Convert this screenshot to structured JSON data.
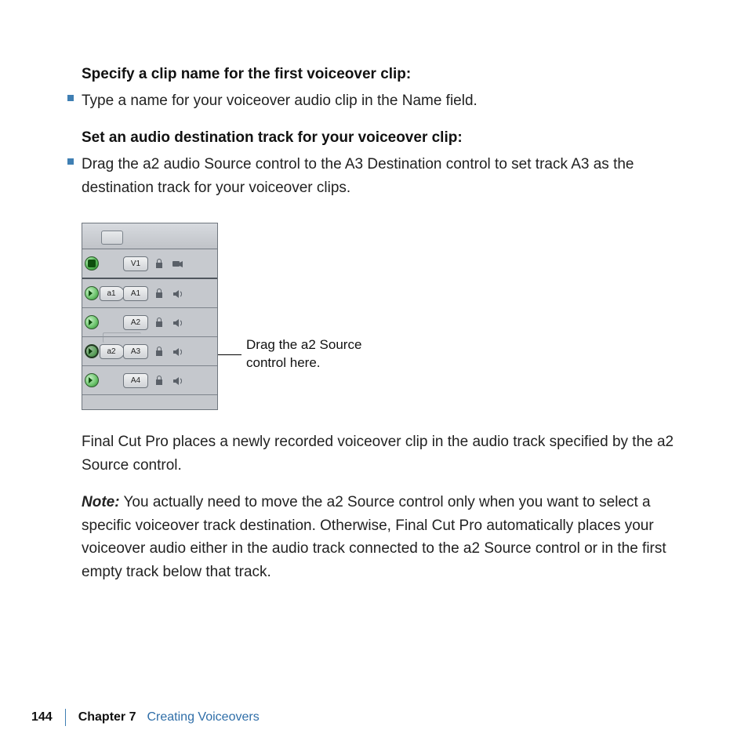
{
  "heading_clipname": "Specify a clip name for the first voiceover clip:",
  "bullet_clipname": "Type a name for your voiceover audio clip in the Name field.",
  "heading_dest": "Set an audio destination track for your voiceover clip:",
  "bullet_dest": "Drag the a2 audio Source control to the A3 Destination control to set track A3 as the destination track for your voiceover clips.",
  "tracks": {
    "video_dest": "V1",
    "a1_src": "a1",
    "a1_dest": "A1",
    "a2_dest": "A2",
    "a3_src": "a2",
    "a3_dest": "A3",
    "a4_dest": "A4"
  },
  "callout": "Drag the a2 Source control here.",
  "para_after": "Final Cut Pro places a newly recorded voiceover clip in the audio track specified by the a2 Source control.",
  "note_label": "Note:",
  "note_body": "  You actually need to move the a2 Source control only when you want to select a specific voiceover track destination. Otherwise, Final Cut Pro automatically places your voiceover audio either in the audio track connected to the a2 Source control or in the first empty track below that track.",
  "footer": {
    "page": "144",
    "chapter_label": "Chapter 7",
    "chapter_name": "Creating Voiceovers"
  }
}
